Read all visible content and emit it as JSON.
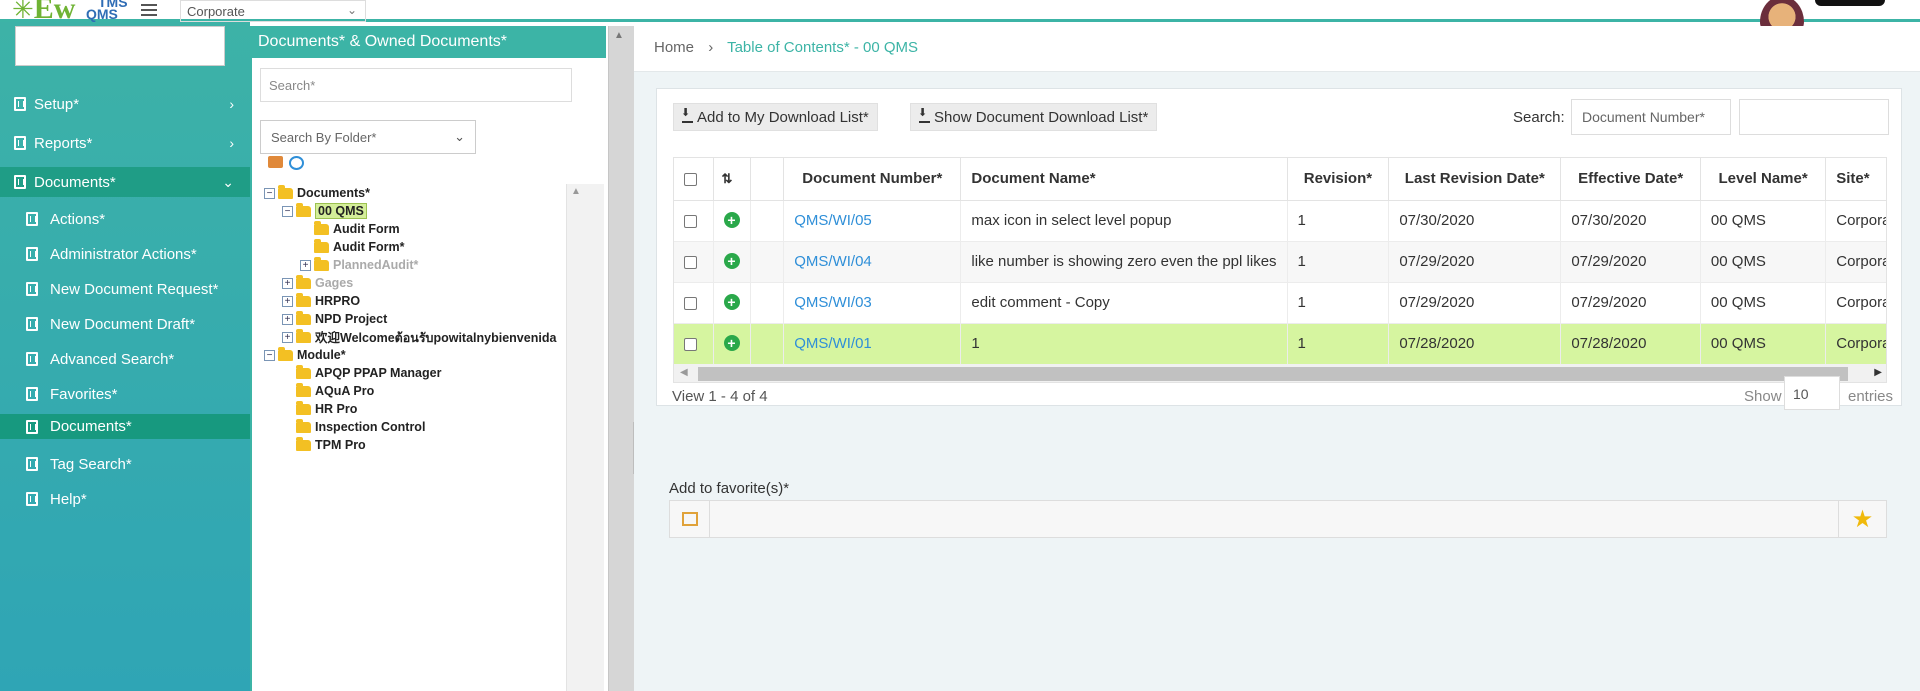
{
  "topbar": {
    "logo_main": "Ew",
    "logo_tms": "TMS",
    "logo_qms": "QMS",
    "site_value": "Corporate"
  },
  "sidebar": {
    "items": [
      {
        "label": "Setup*",
        "arrow": "›"
      },
      {
        "label": "Reports*",
        "arrow": "›"
      },
      {
        "label": "Documents*",
        "arrow": "⌄"
      }
    ],
    "subitems": [
      {
        "label": "Actions*"
      },
      {
        "label": "Administrator Actions*"
      },
      {
        "label": "New Document Request*"
      },
      {
        "label": "New Document Draft*"
      },
      {
        "label": "Advanced Search*"
      },
      {
        "label": "Favorites*"
      },
      {
        "label": "Documents*"
      },
      {
        "label": "Tag Search*"
      },
      {
        "label": "Help*"
      }
    ]
  },
  "tree_panel": {
    "title": "Documents* & Owned Documents*",
    "search_placeholder": "Search*",
    "folder_select": "Search By Folder*",
    "nodes": [
      {
        "label": "Documents*",
        "exp": "−"
      },
      {
        "label": "00 QMS",
        "exp": "−"
      },
      {
        "label": "Audit Form",
        "exp": ""
      },
      {
        "label": "Audit Form*",
        "exp": ""
      },
      {
        "label": "PlannedAudit*",
        "exp": "+"
      },
      {
        "label": "Gages",
        "exp": "+"
      },
      {
        "label": "HRPRO",
        "exp": "+"
      },
      {
        "label": "NPD Project",
        "exp": "+"
      },
      {
        "label": "欢迎Welcomeต้อนรับpowitalnybienvenida",
        "exp": "+"
      },
      {
        "label": "Module*",
        "exp": "−"
      },
      {
        "label": "APQP PPAP Manager",
        "exp": ""
      },
      {
        "label": "AQuA Pro",
        "exp": ""
      },
      {
        "label": "HR Pro",
        "exp": ""
      },
      {
        "label": "Inspection Control",
        "exp": ""
      },
      {
        "label": "TPM Pro",
        "exp": ""
      }
    ]
  },
  "breadcrumb": {
    "home": "Home",
    "sep": "›",
    "current": "Table of Contents* - 00 QMS"
  },
  "toolbar": {
    "add_download": "Add to My Download List*",
    "show_download": "Show Document Download List*",
    "search_label": "Search:",
    "search_field": "Document Number*"
  },
  "table": {
    "headers": [
      "Document Number*",
      "Document Name*",
      "Revision*",
      "Last Revision Date*",
      "Effective Date*",
      "Level Name*",
      "Site*"
    ],
    "rows": [
      {
        "doc_number": "QMS/WI/05",
        "doc_name": "max icon in select level popup",
        "revision": "1",
        "last_rev": "07/30/2020",
        "effective": "07/30/2020",
        "level": "00 QMS",
        "site": "Corporate"
      },
      {
        "doc_number": "QMS/WI/04",
        "doc_name": "like number is showing zero even the ppl likes",
        "revision": "1",
        "last_rev": "07/29/2020",
        "effective": "07/29/2020",
        "level": "00 QMS",
        "site": "Corporate"
      },
      {
        "doc_number": "QMS/WI/03",
        "doc_name": "edit comment - Copy",
        "revision": "1",
        "last_rev": "07/29/2020",
        "effective": "07/29/2020",
        "level": "00 QMS",
        "site": "Corporate"
      },
      {
        "doc_number": "QMS/WI/01",
        "doc_name": "1",
        "revision": "1",
        "last_rev": "07/28/2020",
        "effective": "07/28/2020",
        "level": "00 QMS",
        "site": "Corporate"
      }
    ]
  },
  "pager": {
    "view_text": "View 1 - 4 of 4",
    "show_label": "Show",
    "show_value": "10",
    "entries_label": "entries"
  },
  "favorites": {
    "label": "Add to favorite(s)*"
  },
  "colors": {
    "accent": "#3cb4a6",
    "link": "#2f8fd8",
    "highlight_row": "#d6f5a0"
  }
}
